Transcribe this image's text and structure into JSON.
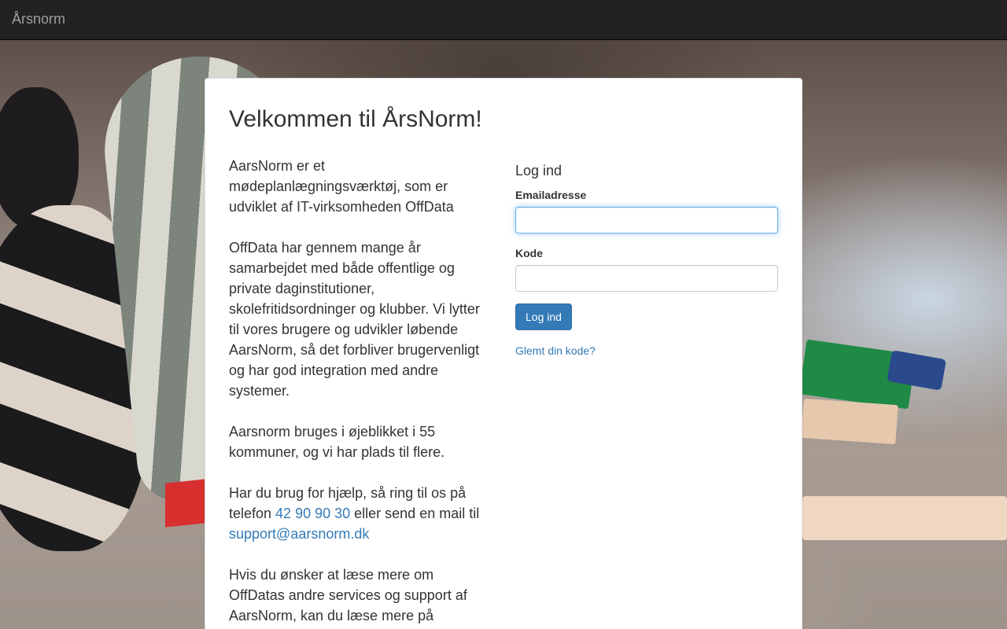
{
  "navbar": {
    "brand": "Årsnorm"
  },
  "main": {
    "title": "Velkommen til ÅrsNorm!",
    "info": {
      "p1": "AarsNorm er et mødeplanlægningsværktøj, som er udviklet af IT-virksomheden OffData",
      "p2": "OffData har gennem mange år samarbejdet med både offentlige og private daginstitutioner, skolefritidsordninger og klubber. Vi lytter til vores brugere og udvikler løbende AarsNorm, så det forbliver brugervenligt og har god integration med andre systemer.",
      "p3": "Aarsnorm bruges i øjeblikket i 55 kommuner, og vi har plads til flere.",
      "p4_prefix": "Har du brug for hjælp, så ring til os på telefon ",
      "phone": "42 90 90 30",
      "p4_mid": " eller send en mail til ",
      "email": "support@aarsnorm.dk",
      "p5": "Hvis du ønsker at læse mere om OffDatas andre services og support af AarsNorm, kan du læse mere på"
    },
    "login": {
      "heading": "Log ind",
      "email_label": "Emailadresse",
      "email_value": "",
      "password_label": "Kode",
      "password_value": "",
      "submit_label": "Log ind",
      "forgot_label": "Glemt din kode?"
    }
  },
  "colors": {
    "navbar_bg": "#222222",
    "brand_text": "#9d9d9d",
    "primary": "#337ab7",
    "link": "#337ab7"
  }
}
